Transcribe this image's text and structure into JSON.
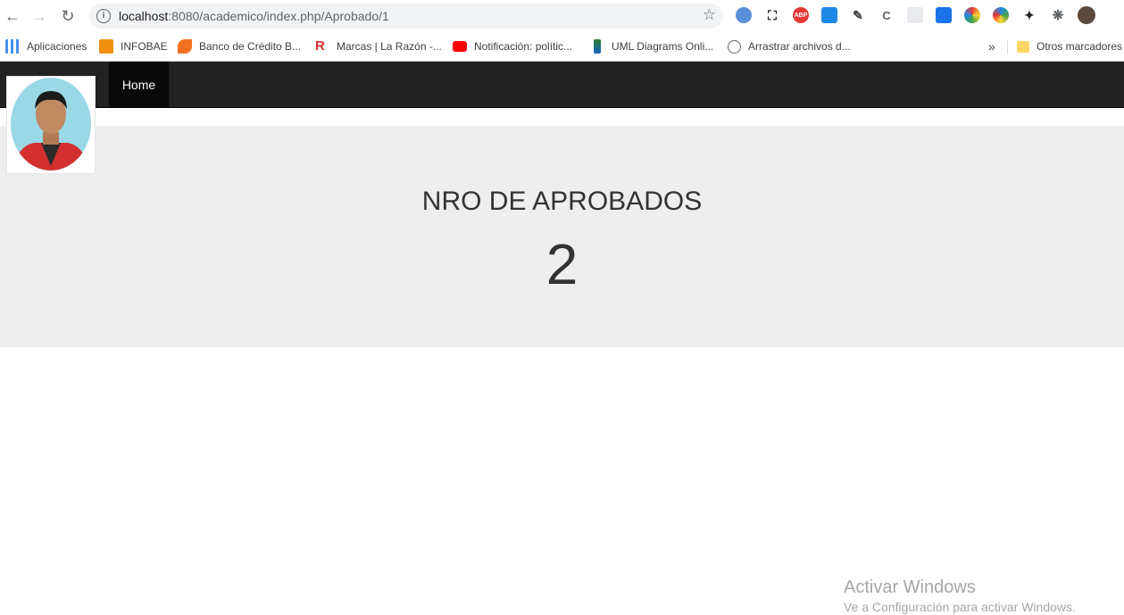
{
  "browser": {
    "url_host": "localhost",
    "url_path": ":8080/academico/index.php/Aprobado/1"
  },
  "bookmarks": {
    "items": [
      {
        "label": "Aplicaciones",
        "color": "#1a73e8"
      },
      {
        "label": "INFOBAE",
        "color": "#f29111"
      },
      {
        "label": "Banco de Crédito B...",
        "color": "#f37021"
      },
      {
        "label": "Marcas | La Razón -...",
        "color": "#d32f2f"
      },
      {
        "label": "Notificación: polític...",
        "color": "#ff0000"
      },
      {
        "label": "UML Diagrams Onli...",
        "color": "#2e7d32"
      },
      {
        "label": "Arrastrar archivos d...",
        "color": "#5f6368"
      }
    ],
    "overflow": "»",
    "other": "Otros marcadores"
  },
  "navbar": {
    "home": "Home",
    "bg": "#222222"
  },
  "main": {
    "title": "NRO DE APROBADOS",
    "value": "2"
  },
  "windows": {
    "line1": "Activar Windows",
    "line2": "Ve a Configuración para activar Windows."
  }
}
